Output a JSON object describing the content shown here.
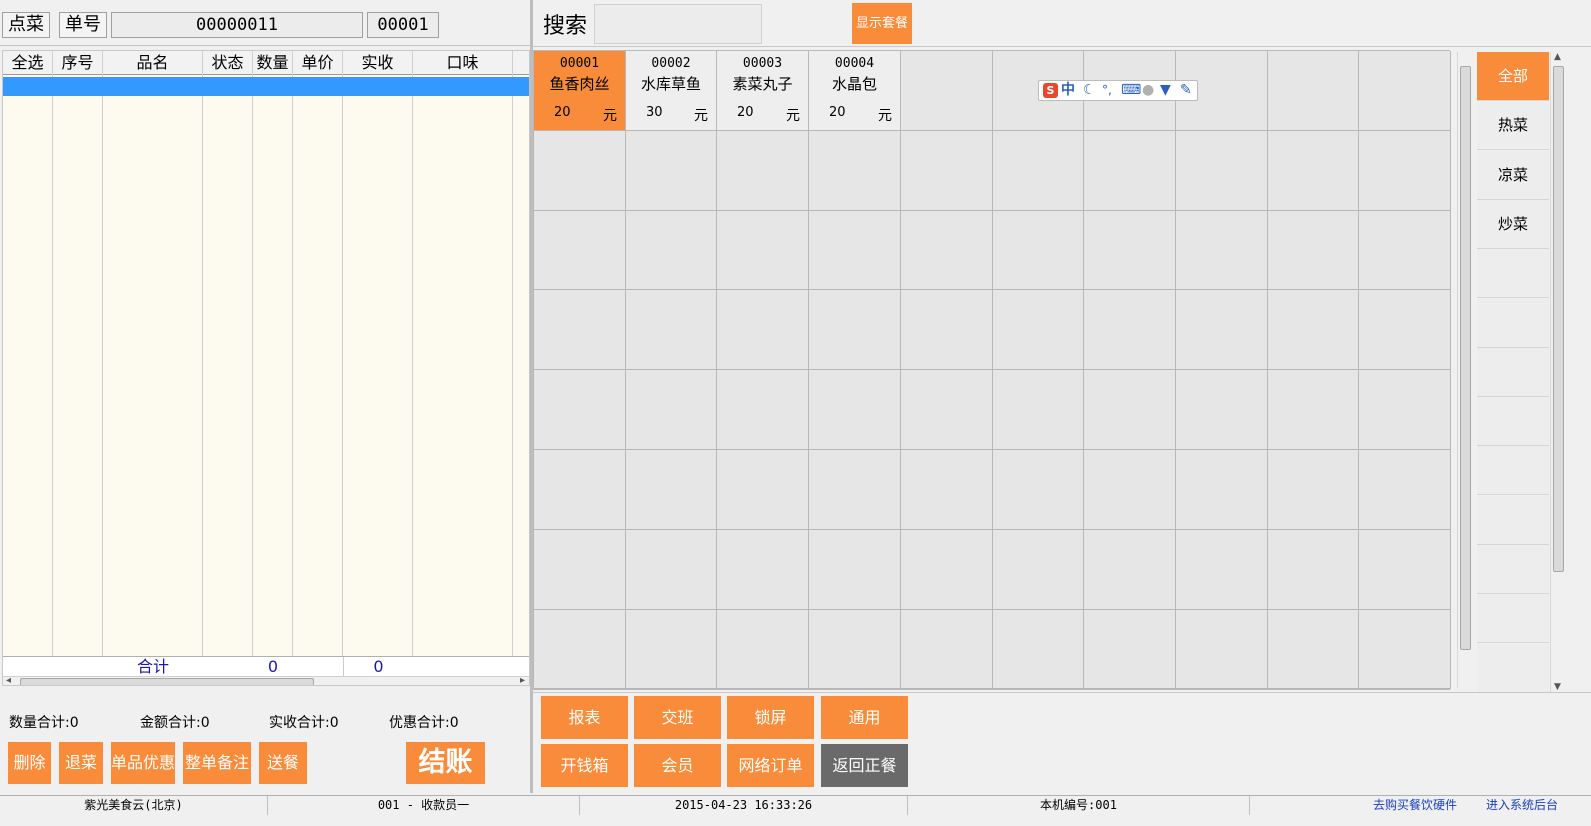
{
  "order_bar": {
    "order_label": "点菜",
    "number_label": "单号",
    "order_no": "00000011",
    "table_no": "00001"
  },
  "grid": {
    "columns": [
      "全选",
      "序号",
      "品名",
      "状态",
      "数量",
      "单价",
      "实收",
      "口味"
    ],
    "total_label": "合计",
    "total_qty": "0",
    "total_received": "0"
  },
  "summary": {
    "qty": "数量合计:0",
    "amount": "金额合计:0",
    "received": "实收合计:0",
    "discount": "优惠合计:0"
  },
  "left_buttons": {
    "delete": "删除",
    "return": "退菜",
    "item_discount": "单品优惠",
    "order_note": "整单备注",
    "send": "送餐",
    "checkout": "结账"
  },
  "search": {
    "label": "搜索",
    "value": "",
    "show_combo": "显示套餐"
  },
  "dishes": [
    {
      "code": "00001",
      "name": "鱼香肉丝",
      "price": "20",
      "unit": "元"
    },
    {
      "code": "00002",
      "name": "水库草鱼",
      "price": "30",
      "unit": "元"
    },
    {
      "code": "00003",
      "name": "素菜丸子",
      "price": "20",
      "unit": "元"
    },
    {
      "code": "00004",
      "name": "水晶包",
      "price": "20",
      "unit": "元"
    }
  ],
  "categories": [
    "全部",
    "热菜",
    "凉菜",
    "炒菜"
  ],
  "actions": {
    "report": "报表",
    "shift": "交班",
    "lock": "锁屏",
    "general": "通用",
    "cash_drawer": "开钱箱",
    "member": "会员",
    "online_order": "网络订单",
    "back": "返回正餐"
  },
  "ime": {
    "mode": "中"
  },
  "status": {
    "company": "紫光美食云(北京)",
    "cashier": "001 - 收款员一",
    "datetime": "2015-04-23 16:33:26",
    "machine": "本机编号:001",
    "buy_hw": "去购买餐饮硬件",
    "backend": "进入系统后台"
  },
  "colors": {
    "accent": "#f88c3a",
    "selection": "#3399ff",
    "back_button": "#6a6a6a"
  }
}
